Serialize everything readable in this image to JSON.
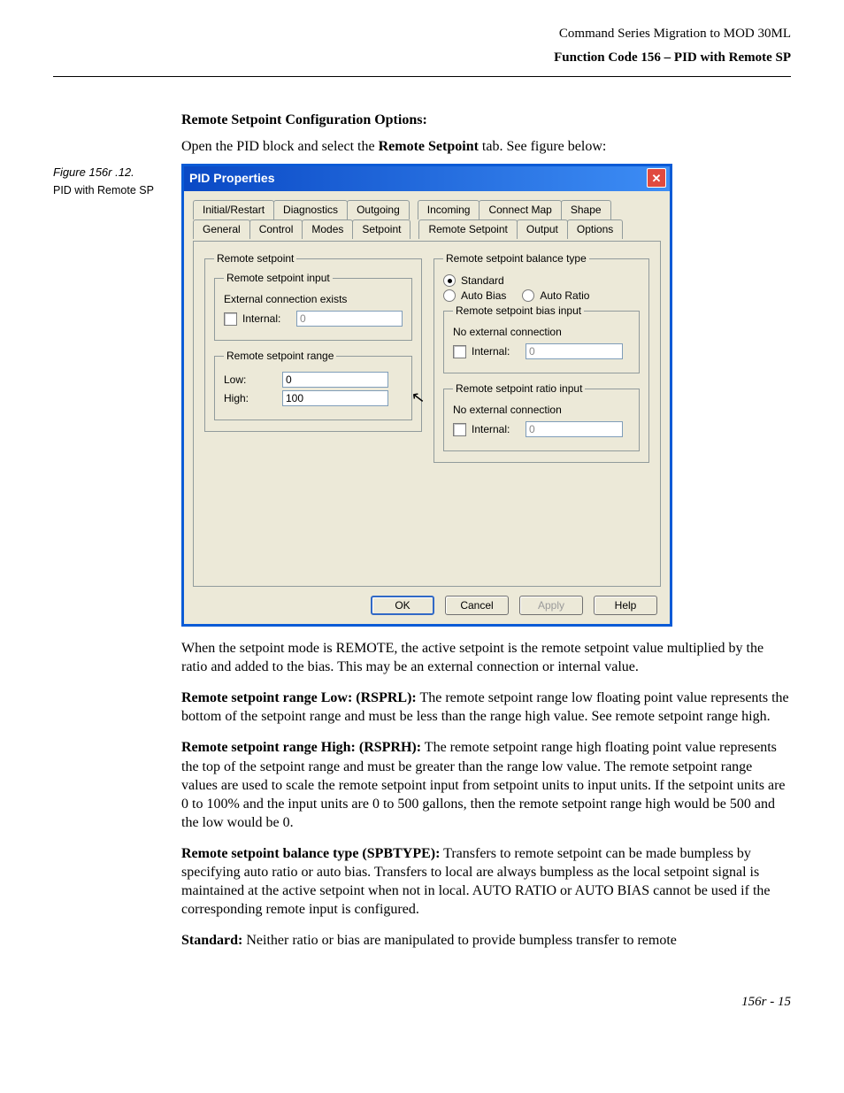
{
  "header": {
    "doc_title": "Command Series Migration to MOD 30ML",
    "section_title": "Function Code 156 – PID with Remote SP"
  },
  "figure": {
    "label": "Figure 156r .12.",
    "caption": "PID with Remote SP"
  },
  "section": {
    "heading": "Remote Setpoint Configuration Options:",
    "intro_prefix": "Open the PID block and select the ",
    "intro_bold": "Remote Setpoint",
    "intro_suffix": " tab. See figure below:"
  },
  "dialog": {
    "title": "PID Properties",
    "tabs_row1": [
      "Initial/Restart",
      "Diagnostics",
      "Outgoing",
      "Incoming",
      "Connect Map",
      "Shape"
    ],
    "tabs_row2": [
      "General",
      "Control",
      "Modes",
      "Setpoint",
      "Remote Setpoint",
      "Output",
      "Options"
    ],
    "selected_tab": "Remote Setpoint",
    "left": {
      "group_remote_setpoint": "Remote setpoint",
      "group_rsp_input": "Remote setpoint input",
      "ext_conn_exists": "External connection exists",
      "internal_label": "Internal:",
      "internal_value": "0",
      "group_rsp_range": "Remote setpoint range",
      "low_label": "Low:",
      "low_value": "0",
      "high_label": "High:",
      "high_value": "100"
    },
    "right": {
      "group_balance_type": "Remote setpoint balance type",
      "radio_standard": "Standard",
      "radio_auto_bias": "Auto Bias",
      "radio_auto_ratio": "Auto Ratio",
      "group_bias_input": "Remote setpoint bias input",
      "no_ext_conn": "No external connection",
      "internal_label": "Internal:",
      "bias_value": "0",
      "group_ratio_input": "Remote setpoint ratio input",
      "ratio_value": "0"
    },
    "buttons": {
      "ok": "OK",
      "cancel": "Cancel",
      "apply": "Apply",
      "help": "Help"
    }
  },
  "paragraphs": {
    "p1": "When the setpoint mode is REMOTE, the active setpoint is the remote setpoint value multiplied by the ratio and added to the bias.  This may be an external connection or internal value.",
    "p2_lead": "Remote setpoint range Low: (RSPRL):",
    "p2_body": " The remote setpoint range low floating point value represents the bottom of the setpoint range and must be less than the range high value.  See remote setpoint range high.",
    "p3_lead": "Remote setpoint range High: (RSPRH):",
    "p3_body": " The remote setpoint range high floating point value represents the top of the setpoint range and must be greater than the range low value.  The remote setpoint range values are used to scale the remote setpoint input from setpoint units to input units.  If the setpoint units are 0 to 100% and the input units are 0 to 500 gallons, then the remote setpoint range high would be 500 and the low would be 0.",
    "p4_lead": "Remote setpoint balance type (SPBTYPE):",
    "p4_body": " Transfers to remote setpoint can be made bumpless by specifying auto ratio or auto bias.  Transfers to local are always bumpless as the local setpoint signal is maintained at the active setpoint when not in local.  AUTO RATIO or AUTO BIAS cannot be used if the corresponding remote input is configured.",
    "p5_lead": "Standard:",
    "p5_body": "  Neither ratio or bias are manipulated to provide bumpless transfer to remote"
  },
  "footer": "156r - 15"
}
